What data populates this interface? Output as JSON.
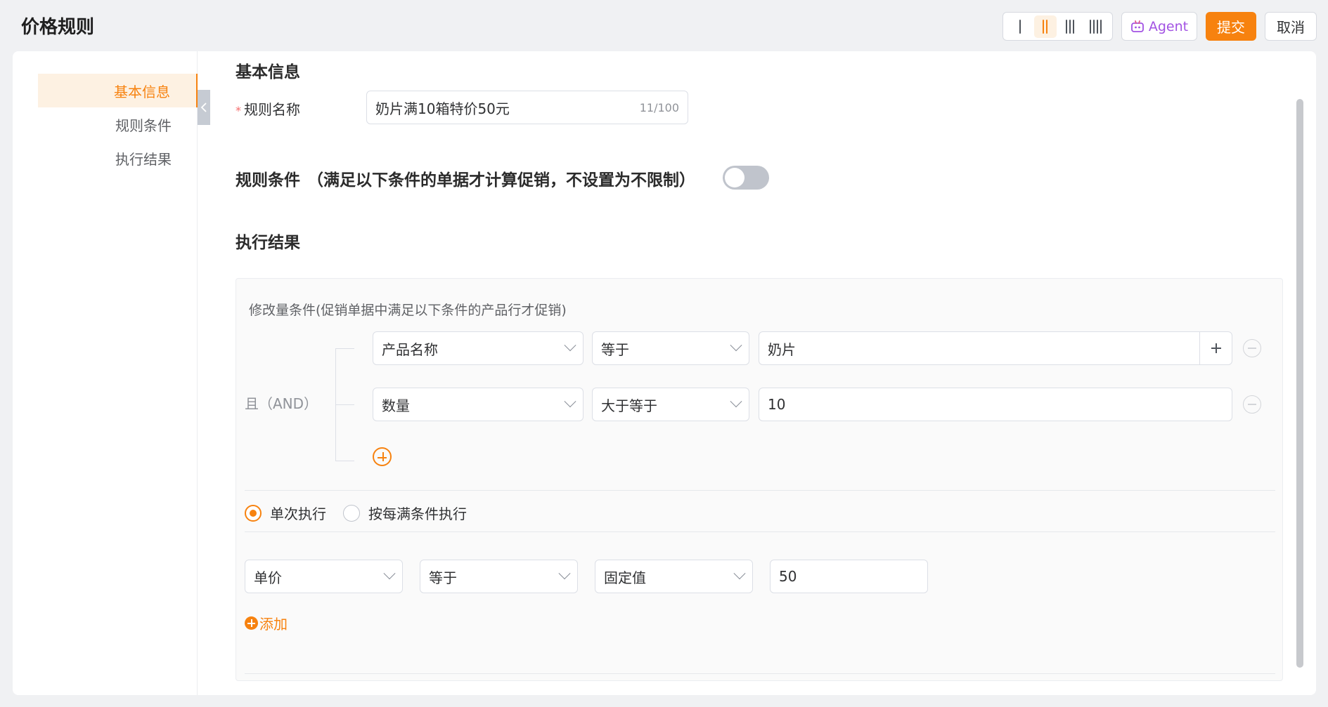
{
  "header": {
    "title": "价格规则",
    "agent_label": "Agent",
    "submit_label": "提交",
    "cancel_label": "取消",
    "column_options": [
      "1",
      "2",
      "3",
      "4"
    ],
    "selected_column": "2"
  },
  "sidebar": {
    "items": [
      {
        "label": "基本信息",
        "active": true
      },
      {
        "label": "规则条件",
        "active": false
      },
      {
        "label": "执行结果",
        "active": false
      }
    ]
  },
  "basic": {
    "title": "基本信息",
    "name_label": "规则名称",
    "name_value": "奶片满10箱特价50元",
    "name_count": "11/100"
  },
  "conditions": {
    "title": "规则条件",
    "note": "（满足以下条件的单据才计算促销，不设置为不限制）",
    "enabled": false
  },
  "result": {
    "title": "执行结果",
    "box_title": "修改量条件(促销单据中满足以下条件的产品行才促销)",
    "logic_label": "且（AND）",
    "rows": [
      {
        "field": "产品名称",
        "operator": "等于",
        "value": "奶片"
      },
      {
        "field": "数量",
        "operator": "大于等于",
        "value": "10"
      }
    ],
    "exec_options": [
      {
        "label": "单次执行",
        "selected": true
      },
      {
        "label": "按每满条件执行",
        "selected": false
      }
    ],
    "action": {
      "field": "单价",
      "operator": "等于",
      "type": "固定值",
      "value": "50"
    },
    "add_label": "添加"
  },
  "colors": {
    "accent": "#f7820f",
    "agent": "#a252e3"
  }
}
